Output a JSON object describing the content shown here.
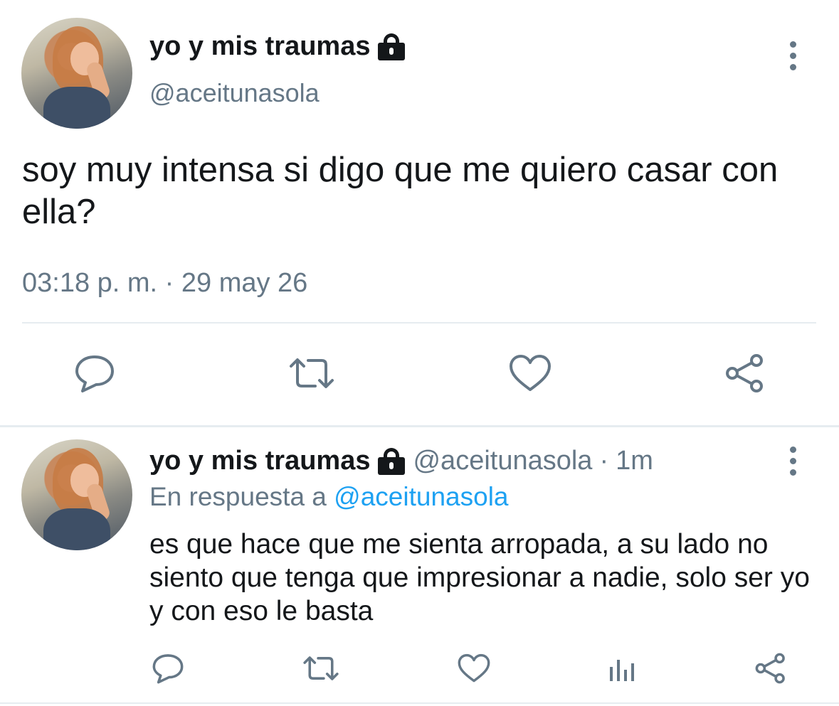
{
  "main_tweet": {
    "display_name": "yo y mis traumas",
    "handle": "@aceitunasola",
    "text": "soy muy intensa si digo que me quiero casar con ella?",
    "timestamp": "03:18 p. m. · 29 may 26",
    "actions": [
      "reply-icon",
      "retweet-icon",
      "like-icon",
      "share-icon"
    ]
  },
  "reply_tweet": {
    "display_name": "yo y mis traumas",
    "handle": "@aceitunasola",
    "separator": "·",
    "time": "1m",
    "reply_prefix": "En respuesta a",
    "reply_mention": "@aceitunasola",
    "text": "es que hace que me sienta arropada, a su lado no siento que tenga que impresionar a nadie, solo ser yo y con eso le basta",
    "actions": [
      "reply-icon",
      "retweet-icon",
      "like-icon",
      "analytics-icon",
      "share-icon"
    ]
  },
  "colors": {
    "text": "#14171a",
    "secondary": "#657786",
    "link": "#1da1f2",
    "divider": "#e6ecf0"
  }
}
